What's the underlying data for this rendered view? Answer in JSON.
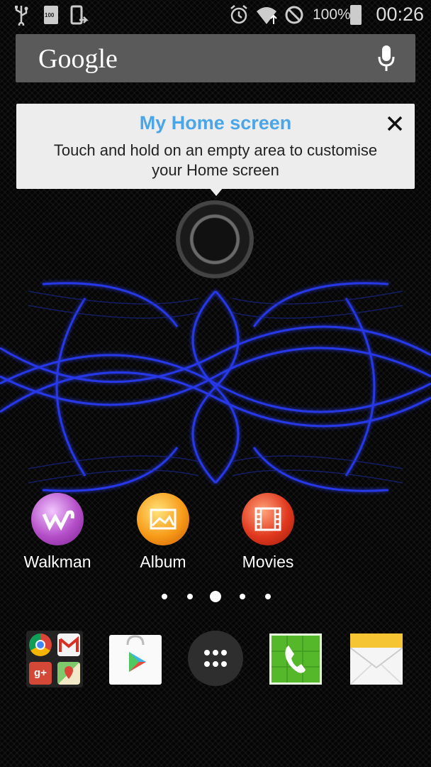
{
  "status_bar": {
    "battery_percent": "100%",
    "time": "00:26",
    "battery_badge": "100",
    "icons": [
      "usb-icon",
      "battery-charging-icon",
      "screenshot-icon",
      "alarm-icon",
      "wifi-icon",
      "do-not-disturb-icon",
      "battery-icon"
    ]
  },
  "search": {
    "logo": "Google",
    "icons": [
      "mic-icon"
    ]
  },
  "tooltip": {
    "title": "My Home screen",
    "body": "Touch and hold on an empty area to customise your Home screen",
    "close_icon": "close-icon"
  },
  "apps": [
    {
      "label": "Walkman",
      "icon": "walkman-icon"
    },
    {
      "label": "Album",
      "icon": "album-icon"
    },
    {
      "label": "Movies",
      "icon": "movies-icon"
    }
  ],
  "pager": {
    "count": 5,
    "active_index": 2
  },
  "dock": [
    {
      "name": "google-folder",
      "icons": [
        "chrome-icon",
        "gmail-icon",
        "google-plus-icon",
        "maps-icon"
      ]
    },
    {
      "name": "play-store",
      "icon": "play-store-icon"
    },
    {
      "name": "app-drawer",
      "icon": "app-drawer-icon"
    },
    {
      "name": "phone",
      "icon": "phone-icon"
    },
    {
      "name": "email",
      "icon": "email-icon"
    }
  ],
  "colors": {
    "tooltip_title": "#4aa6e8",
    "wallpaper_glow": "#2a3cff",
    "search_bar": "#5a5a5a"
  }
}
